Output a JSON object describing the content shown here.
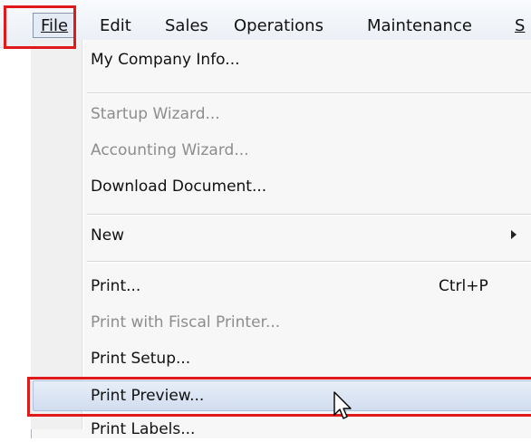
{
  "menubar": {
    "items": [
      {
        "label": "File"
      },
      {
        "label": "Edit"
      },
      {
        "label": "Sales"
      },
      {
        "label": "Operations"
      },
      {
        "label": "Maintenance"
      },
      {
        "label": "S"
      }
    ]
  },
  "file_menu": {
    "items": [
      {
        "label": "My Company Info...",
        "enabled": true
      },
      {
        "label": "Startup Wizard...",
        "enabled": false
      },
      {
        "label": "Accounting Wizard...",
        "enabled": false
      },
      {
        "label": "Download Document...",
        "enabled": true
      },
      {
        "label": "New",
        "enabled": true,
        "submenu": true
      },
      {
        "label": "Print...",
        "enabled": true,
        "shortcut": "Ctrl+P"
      },
      {
        "label": "Print with Fiscal Printer...",
        "enabled": false
      },
      {
        "label": "Print Setup...",
        "enabled": true
      },
      {
        "label": "Print Preview...",
        "enabled": true,
        "hovered": true
      },
      {
        "label": "Print Labels...",
        "enabled": true
      }
    ]
  },
  "colors": {
    "highlight_box": "#e0191c",
    "menu_hover": "#d1ddef",
    "disabled_text": "#8d8d8d"
  },
  "icons": {
    "cursor": "arrow-pointer-icon",
    "submenu": "submenu-arrow-icon"
  }
}
